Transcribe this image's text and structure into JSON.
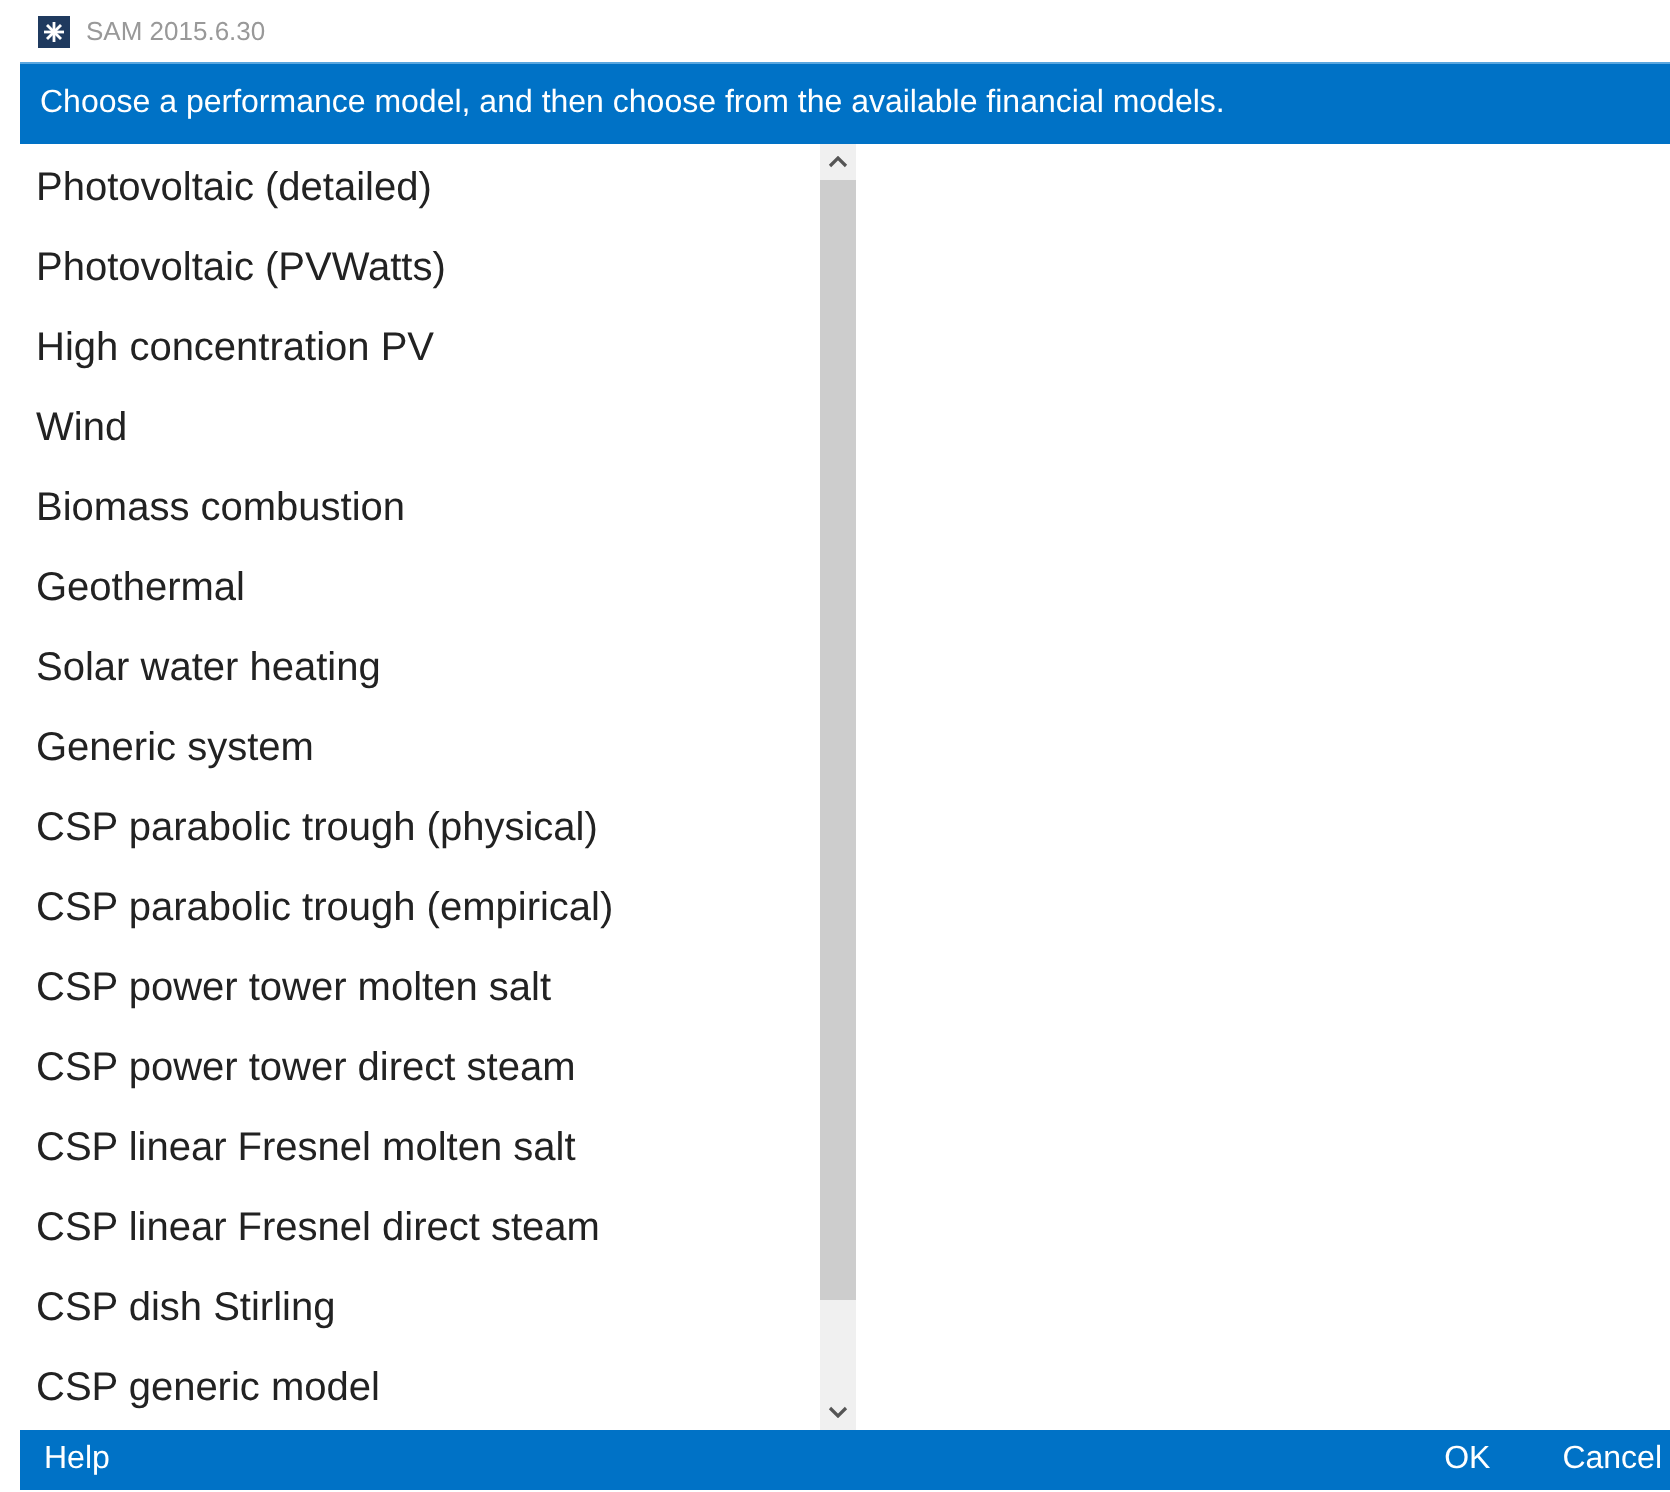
{
  "window": {
    "title": "SAM 2015.6.30"
  },
  "instruction": "Choose a performance model, and then choose from the available financial models.",
  "models": [
    {
      "label": "Photovoltaic (detailed)",
      "selected": false
    },
    {
      "label": "Photovoltaic (PVWatts)",
      "selected": false
    },
    {
      "label": "High concentration PV",
      "selected": false
    },
    {
      "label": "Wind",
      "selected": false
    },
    {
      "label": "Biomass combustion",
      "selected": false
    },
    {
      "label": "Geothermal",
      "selected": false
    },
    {
      "label": "Solar water heating",
      "selected": false
    },
    {
      "label": "Generic system",
      "selected": false
    },
    {
      "label": "CSP parabolic trough (physical)",
      "selected": false
    },
    {
      "label": "CSP parabolic trough (empirical)",
      "selected": false
    },
    {
      "label": "CSP power tower molten salt",
      "selected": false
    },
    {
      "label": "CSP power tower direct steam",
      "selected": false
    },
    {
      "label": "CSP linear Fresnel molten salt",
      "selected": false
    },
    {
      "label": "CSP linear Fresnel direct steam",
      "selected": false
    },
    {
      "label": "CSP dish Stirling",
      "selected": false
    },
    {
      "label": "CSP generic model",
      "selected": false
    }
  ],
  "footer": {
    "help": "Help",
    "buttons": [
      "OK",
      "Cancel"
    ]
  }
}
